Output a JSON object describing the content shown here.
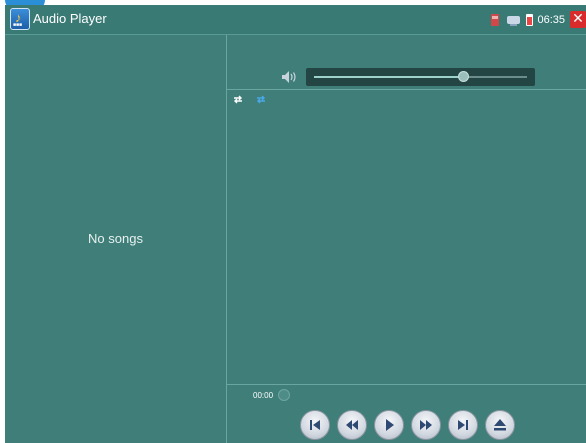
{
  "app": {
    "title": "Audio Player",
    "icon": "music-note-icon"
  },
  "status_bar": {
    "time": "06:35",
    "icons": [
      "sd-card-icon",
      "network-icon",
      "battery-charging-icon",
      "close-icon"
    ],
    "close_color": "#d92b2b"
  },
  "playlist": {
    "empty_text": "No songs"
  },
  "volume": {
    "level": 0.7,
    "icon": "speaker-icon"
  },
  "play_mode": {
    "icons": [
      "repeat-icon",
      "shuffle-repeat-icon"
    ]
  },
  "playback": {
    "elapsed": "00:00",
    "progress": 0
  },
  "controls": [
    {
      "name": "previous-track-button",
      "icon": "skip-previous-icon"
    },
    {
      "name": "rewind-button",
      "icon": "rewind-icon"
    },
    {
      "name": "play-button",
      "icon": "play-icon"
    },
    {
      "name": "fast-forward-button",
      "icon": "fast-forward-icon"
    },
    {
      "name": "next-track-button",
      "icon": "skip-next-icon"
    },
    {
      "name": "eject-button",
      "icon": "eject-icon"
    }
  ],
  "colors": {
    "background": "#3f7e79",
    "titlebar": "#3a7a75",
    "slider_track": "#234644"
  }
}
